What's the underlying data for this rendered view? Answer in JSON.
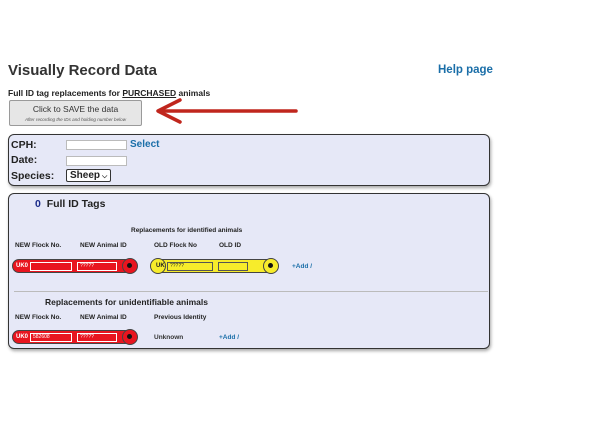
{
  "header": {
    "title": "Visually Record Data",
    "help_link": "Help page"
  },
  "subtitle": {
    "prefix": "Full ID tag replacements for ",
    "emphasis": "PURCHASED",
    "suffix": " animals"
  },
  "save_button": {
    "label": "Click to SAVE the data",
    "hint": "After recording the IDs and holding number below"
  },
  "holding_panel": {
    "cph_label": "CPH:",
    "cph_value": "",
    "select_link": "Select",
    "date_label": "Date:",
    "date_value": "",
    "species_label": "Species:",
    "species_value": "Sheep"
  },
  "tags_panel": {
    "count": "0",
    "heading": "Full ID Tags",
    "identified_section": {
      "title": "Replacements for identified animals",
      "col_new_flock": "NEW Flock No.",
      "col_new_animal": "NEW Animal ID",
      "col_old_flock": "OLD Flock No",
      "col_old_id": "OLD ID",
      "new_country": "UK0",
      "new_flock_value": "",
      "new_animal_value": "?????",
      "old_country": "UK",
      "old_flock_value": "?????",
      "old_id_value": "",
      "add_link": "+Add /"
    },
    "unidentified_section": {
      "title": "Replacements for unidentifiable animals",
      "col_new_flock": "NEW Flock No.",
      "col_new_animal": "NEW Animal ID",
      "col_previous": "Previous Identity",
      "new_country": "UK0",
      "new_flock_value": "582608",
      "new_animal_value": "?????",
      "previous_value": "Unknown",
      "add_link": "+Add /"
    }
  },
  "colors": {
    "accent_link": "#1a6ea8",
    "panel_bg": "#e6e8f7",
    "new_tag": "#e8151f",
    "old_tag": "#f7ec2b",
    "annotation_arrow": "#c0261d"
  }
}
